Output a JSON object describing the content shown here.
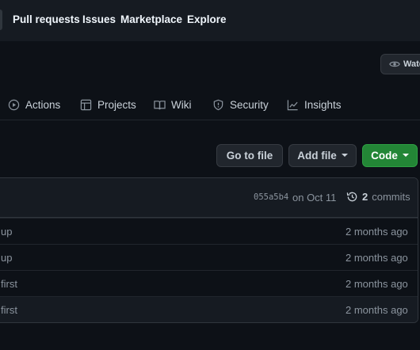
{
  "topnav": {
    "items": [
      {
        "label": "Pull requests"
      },
      {
        "label": "Issues"
      },
      {
        "label": "Marketplace"
      },
      {
        "label": "Explore"
      }
    ]
  },
  "repo": {
    "watch_label": "Watc",
    "tabs": [
      {
        "label": "Actions",
        "icon": "play-icon"
      },
      {
        "label": "Projects",
        "icon": "project-table-icon"
      },
      {
        "label": "Wiki",
        "icon": "book-icon"
      },
      {
        "label": "Security",
        "icon": "shield-icon"
      },
      {
        "label": "Insights",
        "icon": "graph-icon"
      }
    ]
  },
  "toolbar": {
    "go_to_file": "Go to file",
    "add_file": "Add file",
    "code": "Code"
  },
  "latest_commit": {
    "sha": "055a5b4",
    "date": "on Oct 11",
    "count": "2",
    "commits_label": "commits"
  },
  "files": [
    {
      "message": "up",
      "age": "2 months ago"
    },
    {
      "message": "up",
      "age": "2 months ago"
    },
    {
      "message": "first",
      "age": "2 months ago"
    },
    {
      "message": "first",
      "age": "2 months ago"
    }
  ],
  "colors": {
    "background": "#0d1117",
    "header": "#161b22",
    "code_button": "#238636",
    "text": "#c9d1d9",
    "muted": "#8b949e"
  }
}
